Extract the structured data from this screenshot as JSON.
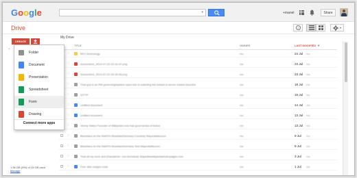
{
  "header": {
    "logo_letters": [
      "G",
      "o",
      "o",
      "g",
      "l",
      "e"
    ],
    "user_name": "+manel",
    "share_label": "Share"
  },
  "app": {
    "title": "Drive",
    "create_label": "CREATE",
    "breadcrumb": "My Drive"
  },
  "create_menu": {
    "items": [
      {
        "label": "Folder",
        "icon": "folder-icon",
        "color": "#8f8f8f"
      },
      {
        "label": "Document",
        "icon": "document-icon",
        "color": "#4285f4"
      },
      {
        "label": "Presentation",
        "icon": "presentation-icon",
        "color": "#f4b400"
      },
      {
        "label": "Spreadsheet",
        "icon": "spreadsheet-icon",
        "color": "#0f9d58"
      },
      {
        "label": "Form",
        "icon": "form-icon",
        "color": "#0f9d58"
      },
      {
        "label": "Drawing",
        "icon": "drawing-icon",
        "color": "#db4437"
      }
    ],
    "connect_label": "Connect more apps"
  },
  "left_edge_label": "+",
  "storage": {
    "usage": "1.56 GB (9%) of 15 GB used",
    "manage": "Manage"
  },
  "columns": {
    "title": "TITLE",
    "owner": "OWNER",
    "last_modified": "LAST MODIFIED",
    "sort_arrow": "▼"
  },
  "files": [
    {
      "name": "RFC technology",
      "owner": "me",
      "date": "24 Jul",
      "who": "me",
      "icon_color": "#f7cb4d"
    },
    {
      "name": "Screenshot_2014-07-22-15-16-37.png",
      "owner": "me",
      "date": "23 Jul",
      "who": "me",
      "icon_color": "#db4437"
    },
    {
      "name": "Screenshot_2014-07-22-15-16-28.png",
      "owner": "me",
      "date": "23 Jul",
      "who": "me",
      "icon_color": "#db4437"
    },
    {
      "name": "That guy is an RM governing/system open into is watching the instant is server instant describe",
      "owner": "me",
      "date": "18 Jul",
      "who": "me",
      "icon_color": "#9e9e9e"
    },
    {
      "name": "ICFTP",
      "owner": "me",
      "date": "15 Jul",
      "who": "me",
      "icon_color": "#9e9e9e"
    },
    {
      "name": "Untitled document",
      "owner": "me",
      "date": "14 Jul",
      "who": "me",
      "icon_color": "#4285f4"
    },
    {
      "name": "Untitled document",
      "owner": "me",
      "date": "13 Jul",
      "who": "me",
      "icon_color": "#4285f4"
    },
    {
      "name": "Jimmy Wales Founder of Wikipedia now has good series of fiction",
      "owner": "me",
      "date": "13 Jul",
      "who": "me",
      "icon_color": "#9e9e9e"
    },
    {
      "name": "Bluesfans do the MaNTH BluesfanGermany Courtesy WapediaIteconn",
      "owner": "me",
      "date": "9 Jul",
      "who": "me",
      "icon_color": "#9e9e9e"
    },
    {
      "name": "Bluesfans do the MaNTH BluesfanGermany Test WapediaIteconn",
      "owner": "me",
      "date": "9 Jul",
      "who": "me",
      "icon_color": "#9e9e9e"
    },
    {
      "name": "That all my work and (Disclaimer: non-technical) Wapedia/wikipedia/indexpages.com",
      "owner": "me",
      "date": "3 Jul",
      "who": "me",
      "icon_color": "#9e9e9e"
    },
    {
      "name": "Free disk usages code",
      "owner": "me",
      "date": "1 Jul",
      "who": "me",
      "icon_color": "#4285f4"
    }
  ]
}
